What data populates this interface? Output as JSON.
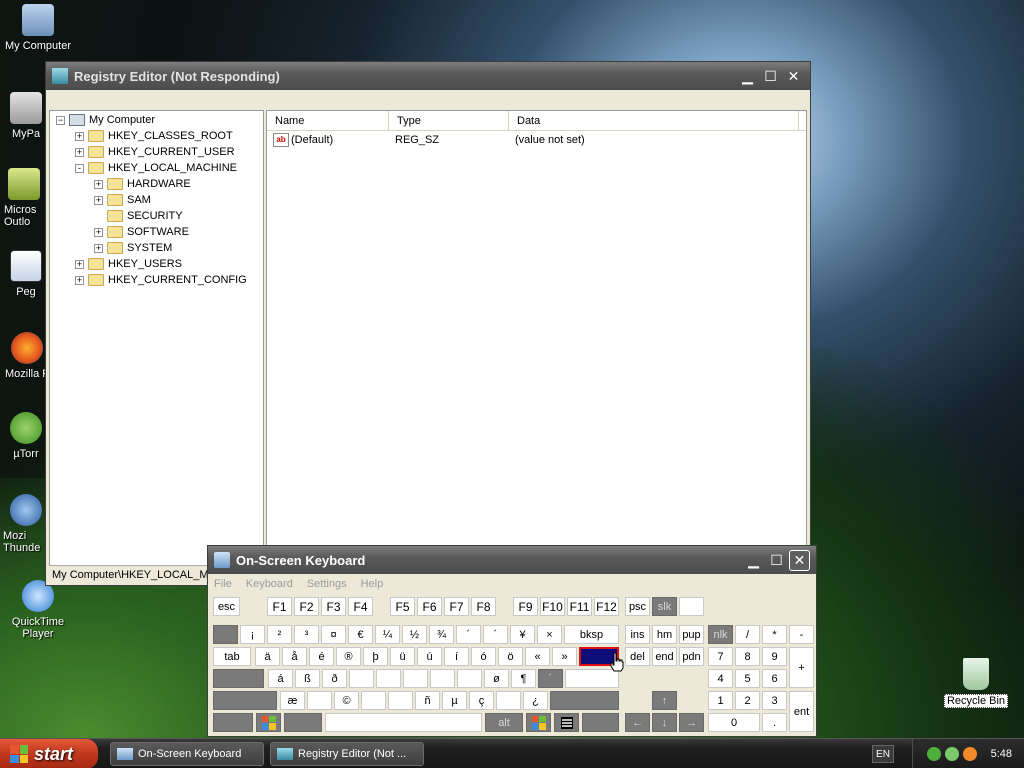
{
  "desktop": {
    "icons": [
      {
        "label": "My Computer"
      },
      {
        "label": "MyPa"
      },
      {
        "label": "Micros Outlo"
      },
      {
        "label": "Peg"
      },
      {
        "label": "Mozilla F"
      },
      {
        "label": "µTorr"
      },
      {
        "label": "Mozi Thunde"
      },
      {
        "label": "QuickTime Player"
      },
      {
        "label": "Recycle Bin"
      }
    ]
  },
  "registry": {
    "title": "Registry Editor (Not Responding)",
    "tree": {
      "root": "My Computer",
      "items": [
        {
          "label": "HKEY_CLASSES_ROOT",
          "exp": "+"
        },
        {
          "label": "HKEY_CURRENT_USER",
          "exp": "+"
        },
        {
          "label": "HKEY_LOCAL_MACHINE",
          "exp": "-"
        },
        {
          "label": "HARDWARE",
          "exp": "+"
        },
        {
          "label": "SAM",
          "exp": "+"
        },
        {
          "label": "SECURITY",
          "exp": ""
        },
        {
          "label": "SOFTWARE",
          "exp": "+"
        },
        {
          "label": "SYSTEM",
          "exp": "+"
        },
        {
          "label": "HKEY_USERS",
          "exp": "+"
        },
        {
          "label": "HKEY_CURRENT_CONFIG",
          "exp": "+"
        }
      ]
    },
    "columns": {
      "name": "Name",
      "type": "Type",
      "data": "Data"
    },
    "rows": [
      {
        "icon": "ab",
        "name": "(Default)",
        "type": "REG_SZ",
        "data": "(value not set)"
      }
    ],
    "status": "My Computer\\HKEY_LOCAL_MAC"
  },
  "osk": {
    "title": "On-Screen Keyboard",
    "menu": {
      "file": "File",
      "keyboard": "Keyboard",
      "settings": "Settings",
      "help": "Help"
    },
    "keys": {
      "esc": "esc",
      "f1": "F1",
      "f2": "F2",
      "f3": "F3",
      "f4": "F4",
      "f5": "F5",
      "f6": "F6",
      "f7": "F7",
      "f8": "F8",
      "f9": "F9",
      "f10": "F10",
      "f11": "F11",
      "f12": "F12",
      "psc": "psc",
      "slk": "slk",
      "r1_1": "¡",
      "r1_2": "²",
      "r1_3": "³",
      "r1_4": "¤",
      "r1_5": "€",
      "r1_6": "¼",
      "r1_7": "½",
      "r1_8": "¾",
      "r1_9": "´",
      "r1_10": "´",
      "r1_11": "¥",
      "r1_12": "×",
      "bksp": "bksp",
      "ins": "ins",
      "hm": "hm",
      "pup": "pup",
      "nlk": "nlk",
      "num_div": "/",
      "num_mul": "*",
      "num_sub": "-",
      "tab": "tab",
      "r2_1": "ä",
      "r2_2": "å",
      "r2_3": "é",
      "r2_4": "®",
      "r2_5": "þ",
      "r2_6": "ü",
      "r2_7": "ú",
      "r2_8": "í",
      "r2_9": "ó",
      "r2_10": "ö",
      "r2_11": "«",
      "r2_12": "»",
      "del": "del",
      "end": "end",
      "pdn": "pdn",
      "n7": "7",
      "n8": "8",
      "n9": "9",
      "num_add": "+",
      "r3_1": "á",
      "r3_2": "ß",
      "r3_3": "ð",
      "r3_4": "ø",
      "r3_5": "¶",
      "r3_6": "´",
      "n4": "4",
      "n5": "5",
      "n6": "6",
      "r4_1": "æ",
      "r4_2": "©",
      "r4_3": "ñ",
      "r4_4": "µ",
      "r4_5": "ç",
      "r4_6": "¿",
      "up": "↑",
      "n1": "1",
      "n2": "2",
      "n3": "3",
      "ent": "ent",
      "alt": "alt",
      "left": "←",
      "down": "↓",
      "right": "→",
      "n0": "0",
      "ndot": "."
    }
  },
  "taskbar": {
    "start": "start",
    "tasks": [
      {
        "label": "On-Screen Keyboard"
      },
      {
        "label": "Registry Editor (Not ..."
      }
    ],
    "lang": "EN",
    "clock": "5:48"
  }
}
